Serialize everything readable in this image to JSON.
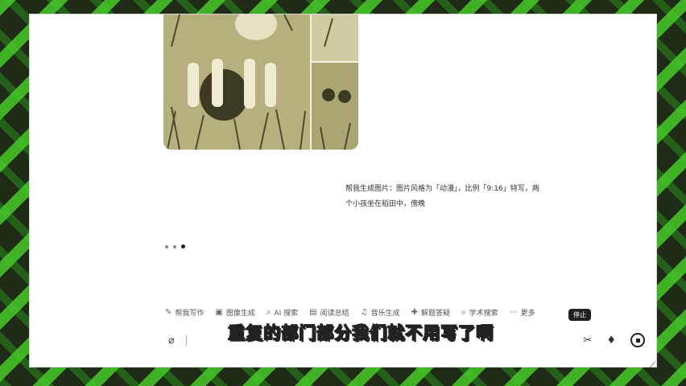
{
  "chat": {
    "prompt_line1": "帮我生成图片：图片风格为「动漫」，比例「9:16」特写，两",
    "prompt_line2": "个小孩坐在稻田中，傍晚"
  },
  "toolbar": {
    "items": [
      {
        "icon": "pen-icon",
        "glyph": "✎",
        "label": "帮我写作"
      },
      {
        "icon": "image-icon",
        "glyph": "▣",
        "label": "图像生成"
      },
      {
        "icon": "ai-search-icon",
        "glyph": "⌕",
        "label": "AI 搜索"
      },
      {
        "icon": "book-icon",
        "glyph": "▤",
        "label": "阅读总结"
      },
      {
        "icon": "music-icon",
        "glyph": "♫",
        "label": "音乐生成"
      },
      {
        "icon": "solve-icon",
        "glyph": "✚",
        "label": "解题答疑"
      },
      {
        "icon": "academic-search-icon",
        "glyph": "⌕",
        "label": "学术搜索"
      },
      {
        "icon": "more-icon",
        "glyph": "⋯",
        "label": "更多"
      }
    ]
  },
  "input": {
    "attach_glyph": "⌀",
    "scissors_glyph": "✂",
    "mic_glyph": "♦"
  },
  "tooltip": "停止",
  "subtitle": "重复的部门部分我们就不用写了啊",
  "resize_glyph": "⟋"
}
